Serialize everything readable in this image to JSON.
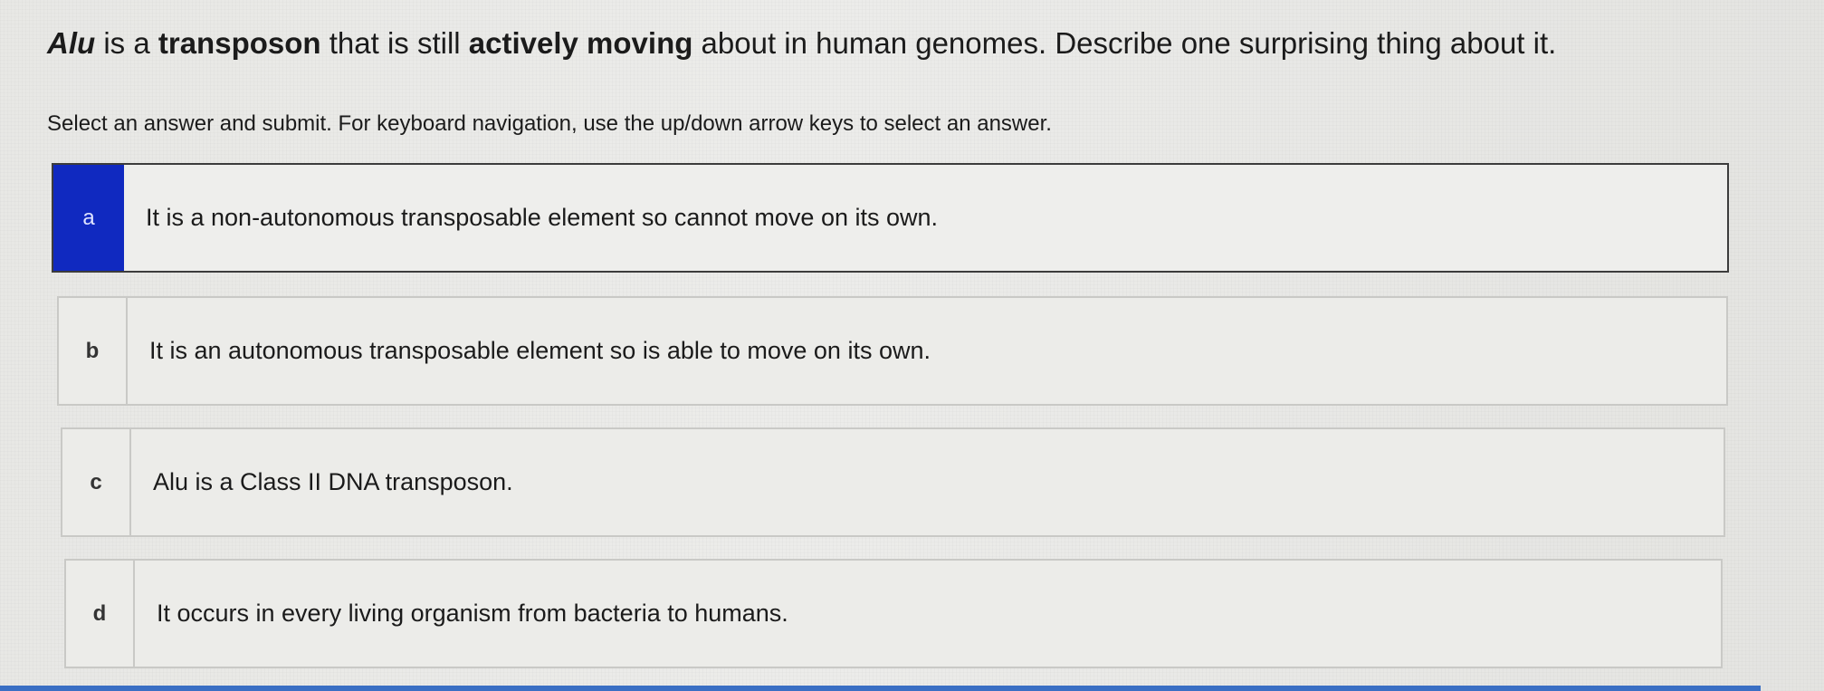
{
  "question": {
    "term": "Alu",
    "part1": " is a ",
    "keyword": "transposon",
    "part2": " that is still ",
    "emphasis": "actively moving",
    "part3": " about in human genomes. Describe one surprising thing about it."
  },
  "instructions": "Select an answer and submit. For keyboard navigation, use the up/down arrow keys to select an answer.",
  "options": [
    {
      "letter": "a",
      "text": "It is a non-autonomous transposable element so cannot move on its own.",
      "selected": true
    },
    {
      "letter": "b",
      "text": "It is an autonomous transposable element so is able to move on its own.",
      "selected": false
    },
    {
      "letter": "c",
      "text": "Alu is a Class II DNA transposon.",
      "selected": false
    },
    {
      "letter": "d",
      "text": "It occurs in every living organism from bacteria to humans.",
      "selected": false
    }
  ],
  "colors": {
    "selected_accent": "#1029c0",
    "bottom_bar": "#3a6fc4"
  }
}
